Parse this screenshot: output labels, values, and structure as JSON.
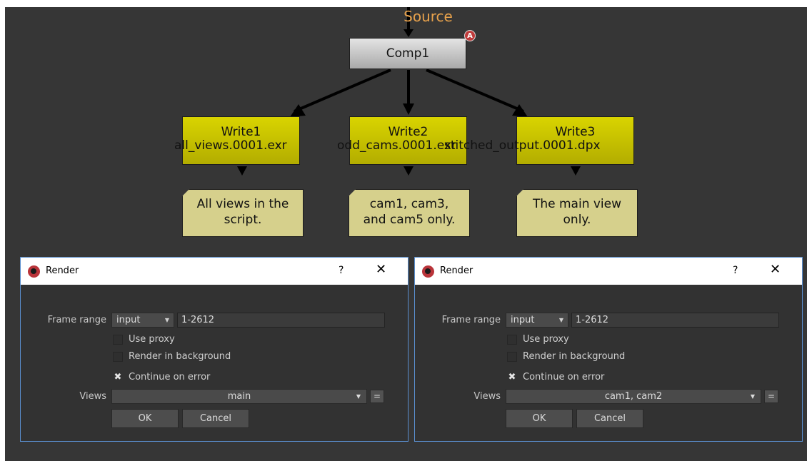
{
  "node_graph": {
    "source_label": "Source",
    "comp_node": {
      "label": "Comp1",
      "badge": "A"
    },
    "write_nodes": [
      {
        "label": "Write1",
        "file": "all_views.0001.exr"
      },
      {
        "label": "Write2",
        "file": "odd_cams.0001.exr"
      },
      {
        "label": "Write3",
        "file": "stitched_output.0001.dpx"
      }
    ],
    "notes": [
      {
        "line1": "All views in the",
        "line2": "script."
      },
      {
        "line1": "cam1, cam3,",
        "line2": "and cam5 only."
      },
      {
        "line1": "The main view",
        "line2": "only."
      }
    ],
    "colors": {
      "write_node": "#d9d400",
      "note": "#d6d08c",
      "source_label": "#e8a24c",
      "badge": "#c03b3b"
    }
  },
  "dialogs": [
    {
      "title": "Render",
      "help": "?",
      "close": "✕",
      "frame_range_label": "Frame range",
      "frame_range_mode": "input",
      "frame_range_value": "1-2612",
      "use_proxy": "Use proxy",
      "render_background": "Render in background",
      "continue_on_error": "Continue on error",
      "continue_on_error_checked": true,
      "views_label": "Views",
      "views_value": "main",
      "equals": "=",
      "ok": "OK",
      "cancel": "Cancel"
    },
    {
      "title": "Render",
      "help": "?",
      "close": "✕",
      "frame_range_label": "Frame range",
      "frame_range_mode": "input",
      "frame_range_value": "1-2612",
      "use_proxy": "Use proxy",
      "render_background": "Render in background",
      "continue_on_error": "Continue on error",
      "continue_on_error_checked": true,
      "views_label": "Views",
      "views_value": "cam1, cam2",
      "equals": "=",
      "ok": "OK",
      "cancel": "Cancel"
    }
  ]
}
